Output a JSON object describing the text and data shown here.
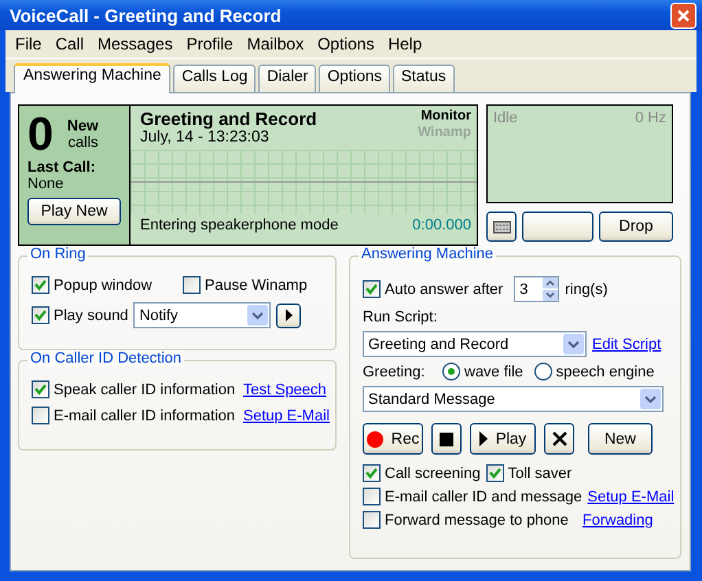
{
  "window": {
    "title": "VoiceCall - Greeting and Record"
  },
  "menu": [
    "File",
    "Call",
    "Messages",
    "Profile",
    "Mailbox",
    "Options",
    "Help"
  ],
  "tabs": [
    {
      "label": "Answering Machine",
      "selected": true
    },
    {
      "label": "Calls Log",
      "selected": false
    },
    {
      "label": "Dialer",
      "selected": false
    },
    {
      "label": "Options",
      "selected": false
    },
    {
      "label": "Status",
      "selected": false
    }
  ],
  "counter": {
    "count": "0",
    "label_top": "New",
    "label_bottom": "calls",
    "last_call_label": "Last Call:",
    "last_call_value": "None",
    "button": "Play New"
  },
  "display": {
    "title": "Greeting and Record",
    "datetime": "July, 14 - 13:23:03",
    "sources": [
      {
        "label": "Monitor",
        "active": true
      },
      {
        "label": "Winamp",
        "active": false
      }
    ],
    "status": "Entering speakerphone mode",
    "time": "0:00.000"
  },
  "line_display": {
    "status": "Idle",
    "frequency": "0 Hz"
  },
  "line_buttons": [
    {
      "kind": "icon"
    },
    {
      "kind": "blank"
    },
    {
      "kind": "text",
      "label": "Drop"
    }
  ],
  "on_ring": {
    "title": "On Ring",
    "popup": {
      "label": "Popup window",
      "checked": true
    },
    "pause": {
      "label": "Pause Winamp",
      "checked": false
    },
    "sound": {
      "label": "Play sound",
      "checked": true
    },
    "sound_select": "Notify"
  },
  "caller_id": {
    "title": "On Caller ID Detection",
    "rows": [
      {
        "label": "Speak caller ID information",
        "checked": true,
        "link": "Test Speech"
      },
      {
        "label": "E-mail caller ID information",
        "checked": false,
        "link": "Setup E-Mail"
      }
    ]
  },
  "answering_machine": {
    "title": "Answering Machine",
    "auto_answer": {
      "label": "Auto answer after",
      "checked": true,
      "value": "3",
      "suffix": "ring(s)"
    },
    "run_script_label": "Run Script:",
    "script_select": "Greeting and Record",
    "edit_link": "Edit Script",
    "greeting_label": "Greeting:",
    "greeting_options": [
      {
        "label": "wave file",
        "selected": true
      },
      {
        "label": "speech engine",
        "selected": false
      }
    ],
    "greeting_select": "Standard Message",
    "buttons": [
      {
        "kind": "rec",
        "label": "Rec"
      },
      {
        "kind": "stop"
      },
      {
        "kind": "play",
        "label": "Play"
      },
      {
        "kind": "delete"
      },
      {
        "kind": "text",
        "label": "New"
      }
    ],
    "options": [
      {
        "label": "Call screening",
        "checked": true
      },
      {
        "label": "Toll saver",
        "checked": true
      }
    ],
    "rows": [
      {
        "label": "E-mail caller ID and message",
        "checked": false,
        "link": "Setup E-Mail"
      },
      {
        "label": "Forward message to phone",
        "checked": false,
        "link": "Forwading"
      }
    ]
  }
}
